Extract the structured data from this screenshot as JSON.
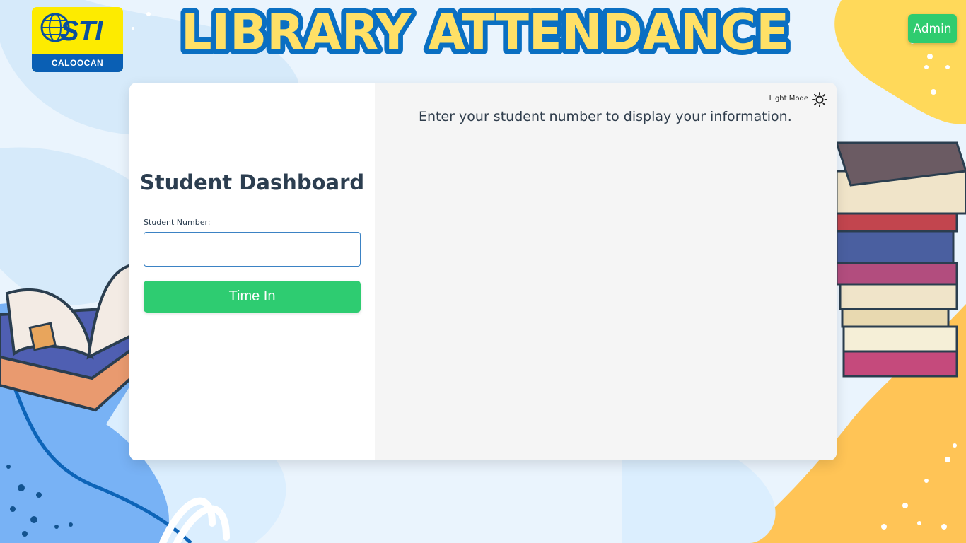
{
  "header": {
    "logo": {
      "brand_text": "STI",
      "campus": "CALOOCAN"
    },
    "title": "LIBRARY ATTENDANCE",
    "admin_button": "Admin"
  },
  "dashboard": {
    "title": "Student Dashboard",
    "student_number_label": "Student Number:",
    "student_number_value": "",
    "time_in_button": "Time In"
  },
  "info_panel": {
    "mode_toggle_label": "Light Mode",
    "mode_icon": "sun-icon",
    "message": "Enter your student number to display your information."
  },
  "colors": {
    "accent_green": "#2ecc71",
    "title_yellow": "#ffe066",
    "title_outline": "#0a6fc2",
    "text_dark": "#2c3e50"
  }
}
